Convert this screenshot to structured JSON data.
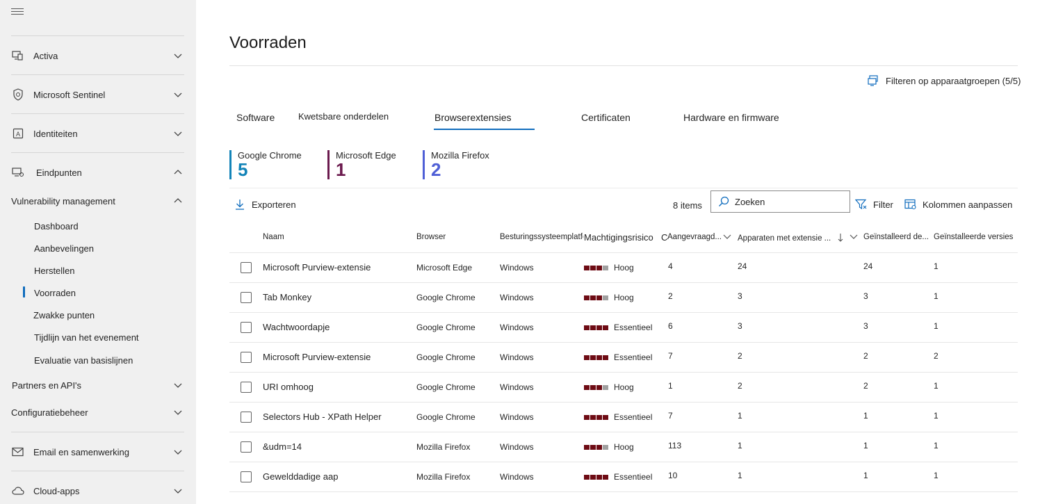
{
  "sidebar": {
    "groups": [
      {
        "label": "Activa",
        "icon": "devices-icon"
      },
      {
        "label": "Microsoft Sentinel",
        "icon": "shield-icon"
      },
      {
        "label": "Identiteiten",
        "icon": "id-card-icon"
      },
      {
        "label": "Eindpunten",
        "icon": "endpoint-icon"
      }
    ],
    "vulnerability": "Vulnerability management",
    "sub_items": [
      "Dashboard",
      "Aanbevelingen",
      "Herstellen",
      "Voorraden",
      "Zwakke punten",
      "Tijdlijn van het evenement",
      "Evaluatie van basislijnen"
    ],
    "partners": "Partners en API's",
    "config": "Configuratiebeheer",
    "email": "Email en samenwerking",
    "cloud": "Cloud-apps"
  },
  "page": {
    "title": "Voorraden",
    "filter_groups": "Filteren op apparaatgroepen (5/5)"
  },
  "tabs": [
    "Software",
    "Kwetsbare onderdelen",
    "Browserextensies",
    "Certificaten",
    "Hardware en firmware"
  ],
  "active_tab": "Browserextensies",
  "stats": [
    {
      "label": "Google Chrome",
      "value": "5",
      "color": "#1384b8"
    },
    {
      "label": "Microsoft Edge",
      "value": "1",
      "color": "#6b1a4e"
    },
    {
      "label": "Mozilla Firefox",
      "value": "2",
      "color": "#4f5fd6"
    }
  ],
  "toolbar": {
    "export": "Exporteren",
    "items_count": "8 items",
    "search_placeholder": "Zoeken",
    "filter": "Filter",
    "columns": "Kolommen aanpassen"
  },
  "table": {
    "headers": [
      "Naam",
      "Browser",
      "Besturingssysteemplatfo...",
      "Machtigingsrisico",
      "C",
      "Aangevraagd...",
      "Apparaten met extensie ...",
      "Geïnstalleerd de...",
      "Geïnstalleerde versies"
    ],
    "rows": [
      {
        "name": "Microsoft Purview-extensie",
        "browser": "Microsoft Edge",
        "os": "Windows",
        "risk": "Hoog",
        "requested": "4",
        "devices": "24",
        "installed": "24",
        "versions": "1"
      },
      {
        "name": "Tab Monkey",
        "browser": "Google Chrome",
        "os": "Windows",
        "risk": "Hoog",
        "requested": "2",
        "devices": "3",
        "installed": "3",
        "versions": "1"
      },
      {
        "name": "Wachtwoordapje",
        "browser": "Google Chrome",
        "os": "Windows",
        "risk": "Essentieel",
        "requested": "6",
        "devices": "3",
        "installed": "3",
        "versions": "1"
      },
      {
        "name": "Microsoft Purview-extensie",
        "browser": "Google Chrome",
        "os": "Windows",
        "risk": "Essentieel",
        "requested": "7",
        "devices": "2",
        "installed": "2",
        "versions": "2"
      },
      {
        "name": "URI omhoog",
        "browser": "Google Chrome",
        "os": "Windows",
        "risk": "Hoog",
        "requested": "1",
        "devices": "2",
        "installed": "2",
        "versions": "1"
      },
      {
        "name": "Selectors Hub - XPath Helper",
        "browser": "Google Chrome",
        "os": "Windows",
        "risk": "Essentieel",
        "requested": "7",
        "devices": "1",
        "installed": "1",
        "versions": "1"
      },
      {
        "name": "&udm=14",
        "browser": "Mozilla Firefox",
        "os": "Windows",
        "risk": "Hoog",
        "requested": "113",
        "devices": "1",
        "installed": "1",
        "versions": "1"
      },
      {
        "name": "Gewelddadige aap",
        "browser": "Mozilla Firefox",
        "os": "Windows",
        "risk": "Essentieel",
        "requested": "10",
        "devices": "1",
        "installed": "1",
        "versions": "1"
      }
    ]
  },
  "colors": {
    "accent": "#0f6cbd",
    "risk_dark": "#6e0b14",
    "risk_grey": "#a0a0a0"
  }
}
